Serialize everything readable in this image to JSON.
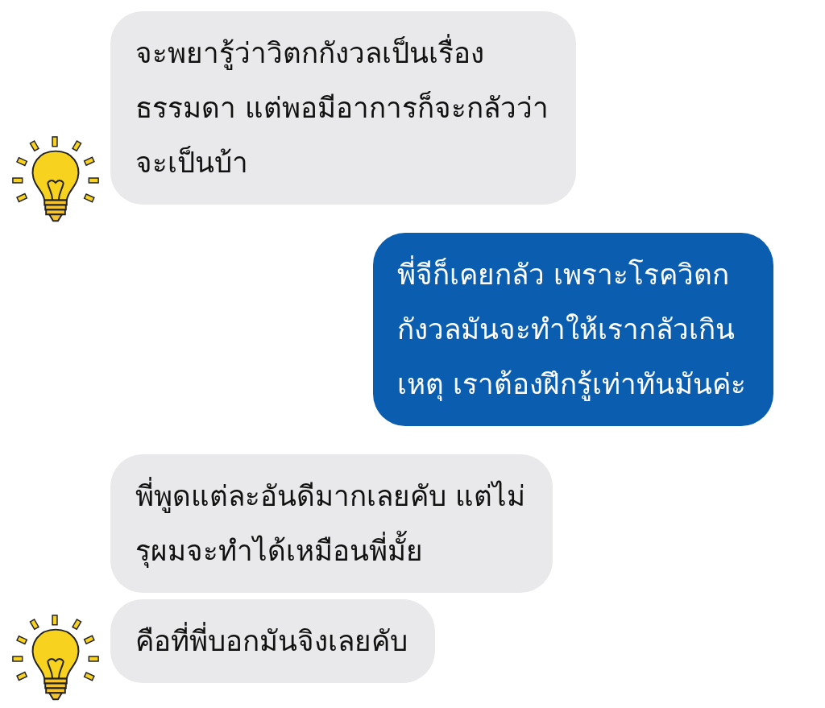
{
  "messages": [
    {
      "kind": "incoming",
      "text": "จะพยารู้ว่าวิตกกังวลเป็นเรื่อง\nธรรมดา แต่พอมีอาการก็จะกลัวว่า\nจะเป็นบ้า",
      "avatar": true
    },
    {
      "kind": "outgoing",
      "text": "พี่จีก็เคยกลัว เพราะโรควิตก\nกังวลมันจะทำให้เรากลัวเกิน\nเหตุ เราต้องฝึกรู้เท่าทันมันค่ะ",
      "avatar": false
    },
    {
      "kind": "incoming",
      "text": "พี่พูดแต่ละอันดีมากเลยคับ แต่ไม่\nรุผมจะทำได้เหมือนพี่มั้ย",
      "avatar": false
    },
    {
      "kind": "incoming",
      "text": "คือที่พี่บอกมันจิงเลยคับ",
      "avatar": true
    }
  ]
}
